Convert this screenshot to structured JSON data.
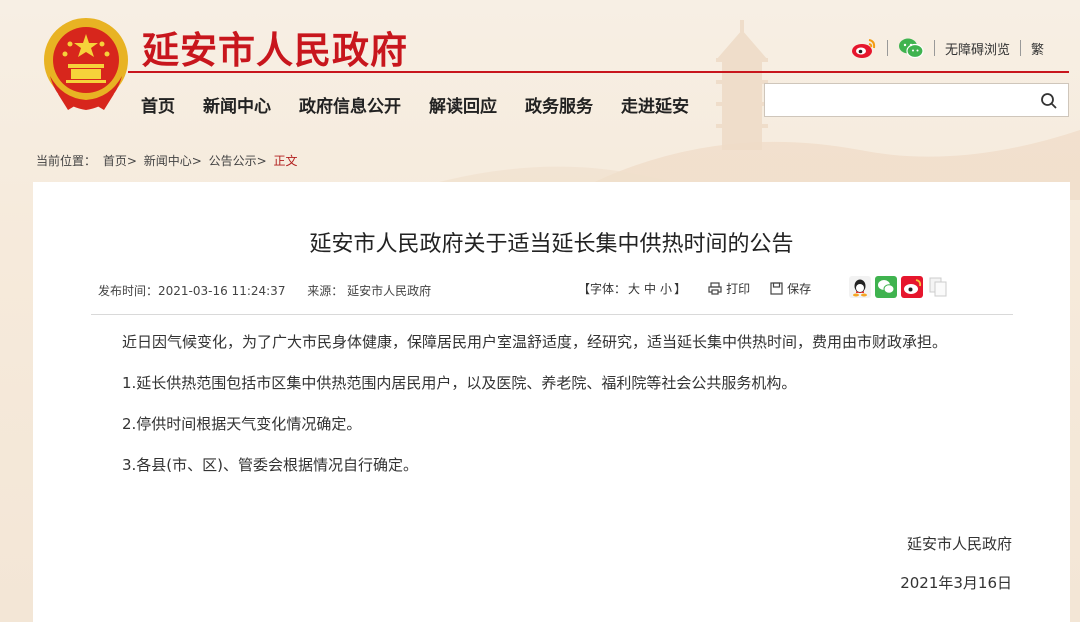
{
  "header": {
    "site_title": "延安市人民政府",
    "tools": {
      "weibo_icon": "weibo-icon",
      "wechat_icon": "wechat-icon",
      "accessibility_label": "无障碍浏览",
      "traditional_label": "繁"
    }
  },
  "nav": {
    "items": [
      "首页",
      "新闻中心",
      "政府信息公开",
      "解读回应",
      "政务服务",
      "走进延安"
    ]
  },
  "search": {
    "value": "",
    "icon": "search-icon"
  },
  "breadcrumb": {
    "prefix": "当前位置：",
    "items": [
      "首页>",
      "新闻中心>",
      "公告公示>"
    ],
    "current": "正文"
  },
  "article": {
    "title": "延安市人民政府关于适当延长集中供热时间的公告",
    "publish_time": "发布时间：2021-03-16 11:24:37",
    "source": "来源： 延安市人民政府",
    "font_size": {
      "open": "【字体：",
      "large": "大",
      "medium": "中",
      "small": "小",
      "close": "】"
    },
    "print_label": "打印",
    "save_label": "保存",
    "share_icons": [
      "qq-icon",
      "wechat-icon",
      "weibo-icon",
      "copy-icon"
    ],
    "paragraphs": [
      "近日因气候变化，为了广大市民身体健康，保障居民用户室温舒适度，经研究，适当延长集中供热时间，费用由市财政承担。",
      "1.延长供热范围包括市区集中供热范围内居民用户，以及医院、养老院、福利院等社会公共服务机构。",
      "2.停供时间根据天气变化情况确定。",
      "3.各县(市、区)、管委会根据情况自行确定。"
    ],
    "signature": "延安市人民政府",
    "date": "2021年3月16日"
  },
  "colors": {
    "brand_red": "#c8161d",
    "background": "#f6eadb",
    "panel": "#ffffff"
  }
}
